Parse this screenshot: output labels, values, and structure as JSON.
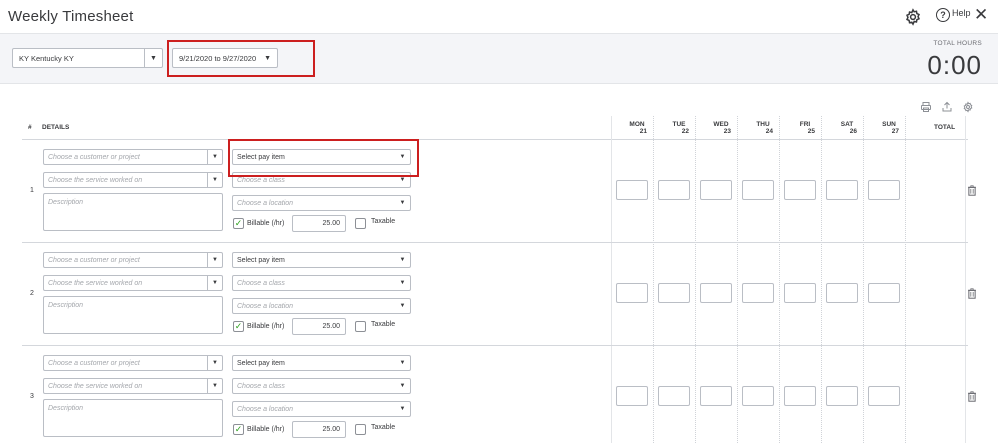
{
  "header": {
    "title": "Weekly Timesheet",
    "help_label": "Help",
    "help_glyph": "?",
    "close_glyph": "✕"
  },
  "filters": {
    "employee": "KY Kentucky KY",
    "date_range": "9/21/2020 to 9/27/2020",
    "total_hours_label": "TOTAL HOURS",
    "total_hours_value": "0:00"
  },
  "table": {
    "hash_label": "#",
    "details_label": "DETAILS",
    "total_label": "TOTAL",
    "days": [
      {
        "dow": "MON",
        "date": "21"
      },
      {
        "dow": "TUE",
        "date": "22"
      },
      {
        "dow": "WED",
        "date": "23"
      },
      {
        "dow": "THU",
        "date": "24"
      },
      {
        "dow": "FRI",
        "date": "25"
      },
      {
        "dow": "SAT",
        "date": "26"
      },
      {
        "dow": "SUN",
        "date": "27"
      }
    ]
  },
  "rows": [
    {
      "num": "1",
      "customer_placeholder": "Choose a customer or project",
      "service_placeholder": "Choose the service worked on",
      "description_placeholder": "Description",
      "pay_item": "Select pay item",
      "class_placeholder": "Choose a class",
      "location_placeholder": "Choose a location",
      "billable_label": "Billable (/hr)",
      "rate": "25.00",
      "taxable_label": "Taxable",
      "billable_checked": true
    },
    {
      "num": "2",
      "customer_placeholder": "Choose a customer or project",
      "service_placeholder": "Choose the service worked on",
      "description_placeholder": "Description",
      "pay_item": "Select pay item",
      "class_placeholder": "Choose a class",
      "location_placeholder": "Choose a location",
      "billable_label": "Billable (/hr)",
      "rate": "25.00",
      "taxable_label": "Taxable",
      "billable_checked": true
    },
    {
      "num": "3",
      "customer_placeholder": "Choose a customer or project",
      "service_placeholder": "Choose the service worked on",
      "description_placeholder": "Description",
      "pay_item": "Select pay item",
      "class_placeholder": "Choose a class",
      "location_placeholder": "Choose a location",
      "billable_label": "Billable (/hr)",
      "rate": "25.00",
      "taxable_label": "Taxable",
      "billable_checked": true
    }
  ],
  "icons": {
    "caret": "▼",
    "check": "✓"
  },
  "colors": {
    "highlight": "#cc1f1f",
    "check_green": "#2ca01c"
  }
}
